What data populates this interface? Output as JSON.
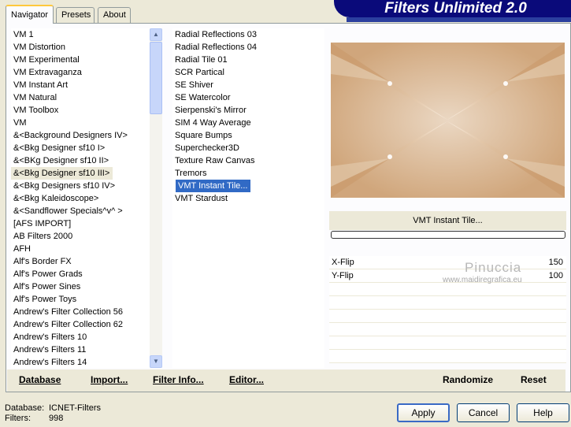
{
  "tabs": [
    {
      "label": "Navigator"
    },
    {
      "label": "Presets"
    },
    {
      "label": "About"
    }
  ],
  "banner": {
    "title": "Filters Unlimited 2.0"
  },
  "categories": {
    "items": [
      "VM 1",
      "VM Distortion",
      "VM Experimental",
      "VM Extravaganza",
      "VM Instant Art",
      "VM Natural",
      "VM Toolbox",
      "VM",
      "&<Background Designers IV>",
      "&<Bkg Designer sf10 I>",
      "&<BKg Designer sf10 II>",
      "&<Bkg Designer sf10 III>",
      "&<Bkg Designers sf10 IV>",
      "&<Bkg Kaleidoscope>",
      "&<Sandflower Specials^v^ >",
      "[AFS IMPORT]",
      "AB Filters 2000",
      "AFH",
      "Alf's Border FX",
      "Alf's Power Grads",
      "Alf's Power Sines",
      "Alf's Power Toys",
      "Andrew's Filter Collection 56",
      "Andrew's Filter Collection 62",
      "Andrew's Filters 10",
      "Andrew's Filters 11",
      "Andrew's Filters 14"
    ],
    "selected_index": 11
  },
  "filters": {
    "items": [
      "Radial Reflections 03",
      "Radial Reflections 04",
      "Radial Tile 01",
      "SCR  Partical",
      "SE Shiver",
      "SE Watercolor",
      "Sierpenski's Mirror",
      "SIM 4 Way Average",
      "Square Bumps",
      "Superchecker3D",
      "Texture Raw Canvas",
      "Tremors",
      "VMT Instant Tile...",
      "VMT Stardust"
    ],
    "selected_index": 12
  },
  "preview": {
    "filter_name": "VMT Instant Tile..."
  },
  "params": [
    {
      "name": "X-Flip",
      "value": "150"
    },
    {
      "name": "Y-Flip",
      "value": "100"
    }
  ],
  "watermark": {
    "title": "Pinuccia",
    "url": "www.maidiregrafica.eu"
  },
  "bottom_links": {
    "database": "Database",
    "import": "Import...",
    "filter_info": "Filter Info...",
    "editor": "Editor...",
    "randomize": "Randomize",
    "reset": "Reset"
  },
  "footer": {
    "database_label": "Database:",
    "database_value": "ICNET-Filters",
    "filters_label": "Filters:",
    "filters_value": "998"
  },
  "buttons": {
    "apply": "Apply",
    "cancel": "Cancel",
    "help": "Help"
  },
  "colors": {
    "selection": "#316ac5",
    "banner": "#0a0a7a"
  }
}
